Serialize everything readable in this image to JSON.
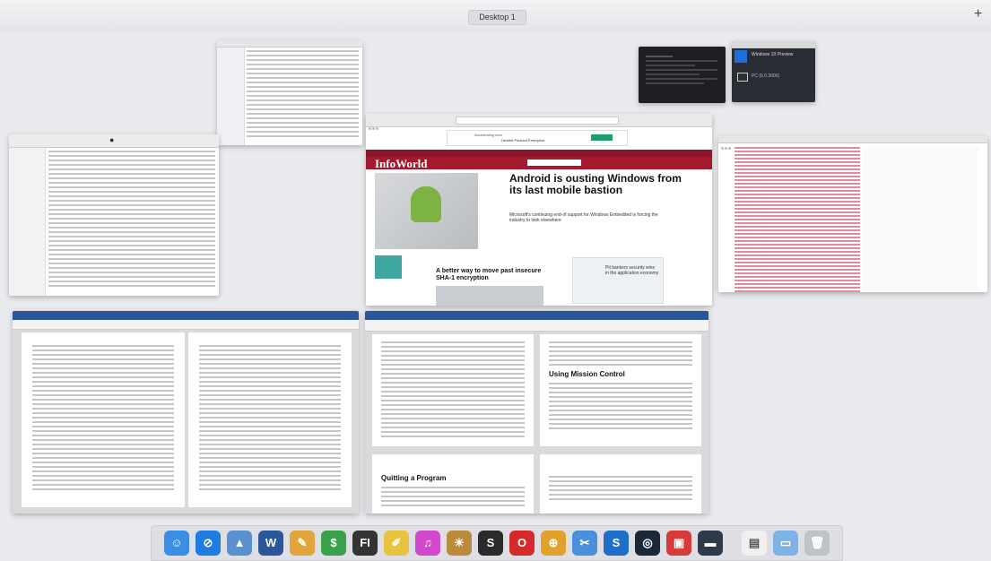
{
  "desktop": {
    "space_label": "Desktop 1",
    "add_symbol": "+"
  },
  "infoworld": {
    "banner": "Accelerating next",
    "banner_brand": "Hewlett Packard Enterprise",
    "logo": "InfoWorld",
    "headline": "Android is ousting Windows from its last mobile bastion",
    "subhead": "Microsoft's continuing end-of support for Windows Embedded is forcing the industry to look elsewhere",
    "story2": "A better way to move past insecure SHA-1 encryption",
    "story3": "Pit bankers security wins in the application economy"
  },
  "remote": {
    "title": "Windows 10 Preview",
    "pc_label": "PC (6.0.3000)"
  },
  "word": {
    "heading": "Using Mission Control",
    "heading2": "Quitting a Program"
  },
  "colors": {
    "infoworld_red": "#8e1628",
    "word_blue": "#2b579a"
  },
  "dock": [
    {
      "name": "finder-icon",
      "label": "☺",
      "color": "#3a8ee6"
    },
    {
      "name": "safari-icon",
      "label": "⊘",
      "color": "#1f7ce0"
    },
    {
      "name": "preview-icon",
      "label": "▲",
      "color": "#5a8fd0"
    },
    {
      "name": "word-icon",
      "label": "W",
      "color": "#2b579a"
    },
    {
      "name": "textedit-icon",
      "label": "✎",
      "color": "#e0a43a"
    },
    {
      "name": "script-icon",
      "label": "$",
      "color": "#39a24a"
    },
    {
      "name": "fi-icon",
      "label": "FI",
      "color": "#333333"
    },
    {
      "name": "notes-icon",
      "label": "✐",
      "color": "#e8c33f"
    },
    {
      "name": "music-icon",
      "label": "♫",
      "color": "#d24acb"
    },
    {
      "name": "sun-icon",
      "label": "☀",
      "color": "#b98b3b"
    },
    {
      "name": "sonos-icon",
      "label": "S",
      "color": "#2a2a2a"
    },
    {
      "name": "opera-icon",
      "label": "O",
      "color": "#d52a2a"
    },
    {
      "name": "globe-icon",
      "label": "⊕",
      "color": "#e3a02c"
    },
    {
      "name": "tools-icon",
      "label": "✂",
      "color": "#4a8fd9"
    },
    {
      "name": "s-app-icon",
      "label": "S",
      "color": "#1f6fc9"
    },
    {
      "name": "steam-icon",
      "label": "◎",
      "color": "#1b2838"
    },
    {
      "name": "remote-icon",
      "label": "▣",
      "color": "#d63a3a"
    },
    {
      "name": "screen-icon",
      "label": "▬",
      "color": "#2d3a4a"
    },
    {
      "name": "document-icon",
      "label": "▤",
      "color": "#f0f0f0"
    },
    {
      "name": "folder-icon",
      "label": "▭",
      "color": "#7fb3e8"
    },
    {
      "name": "trash-icon",
      "label": "🗑",
      "color": "#bfc3c8"
    }
  ]
}
